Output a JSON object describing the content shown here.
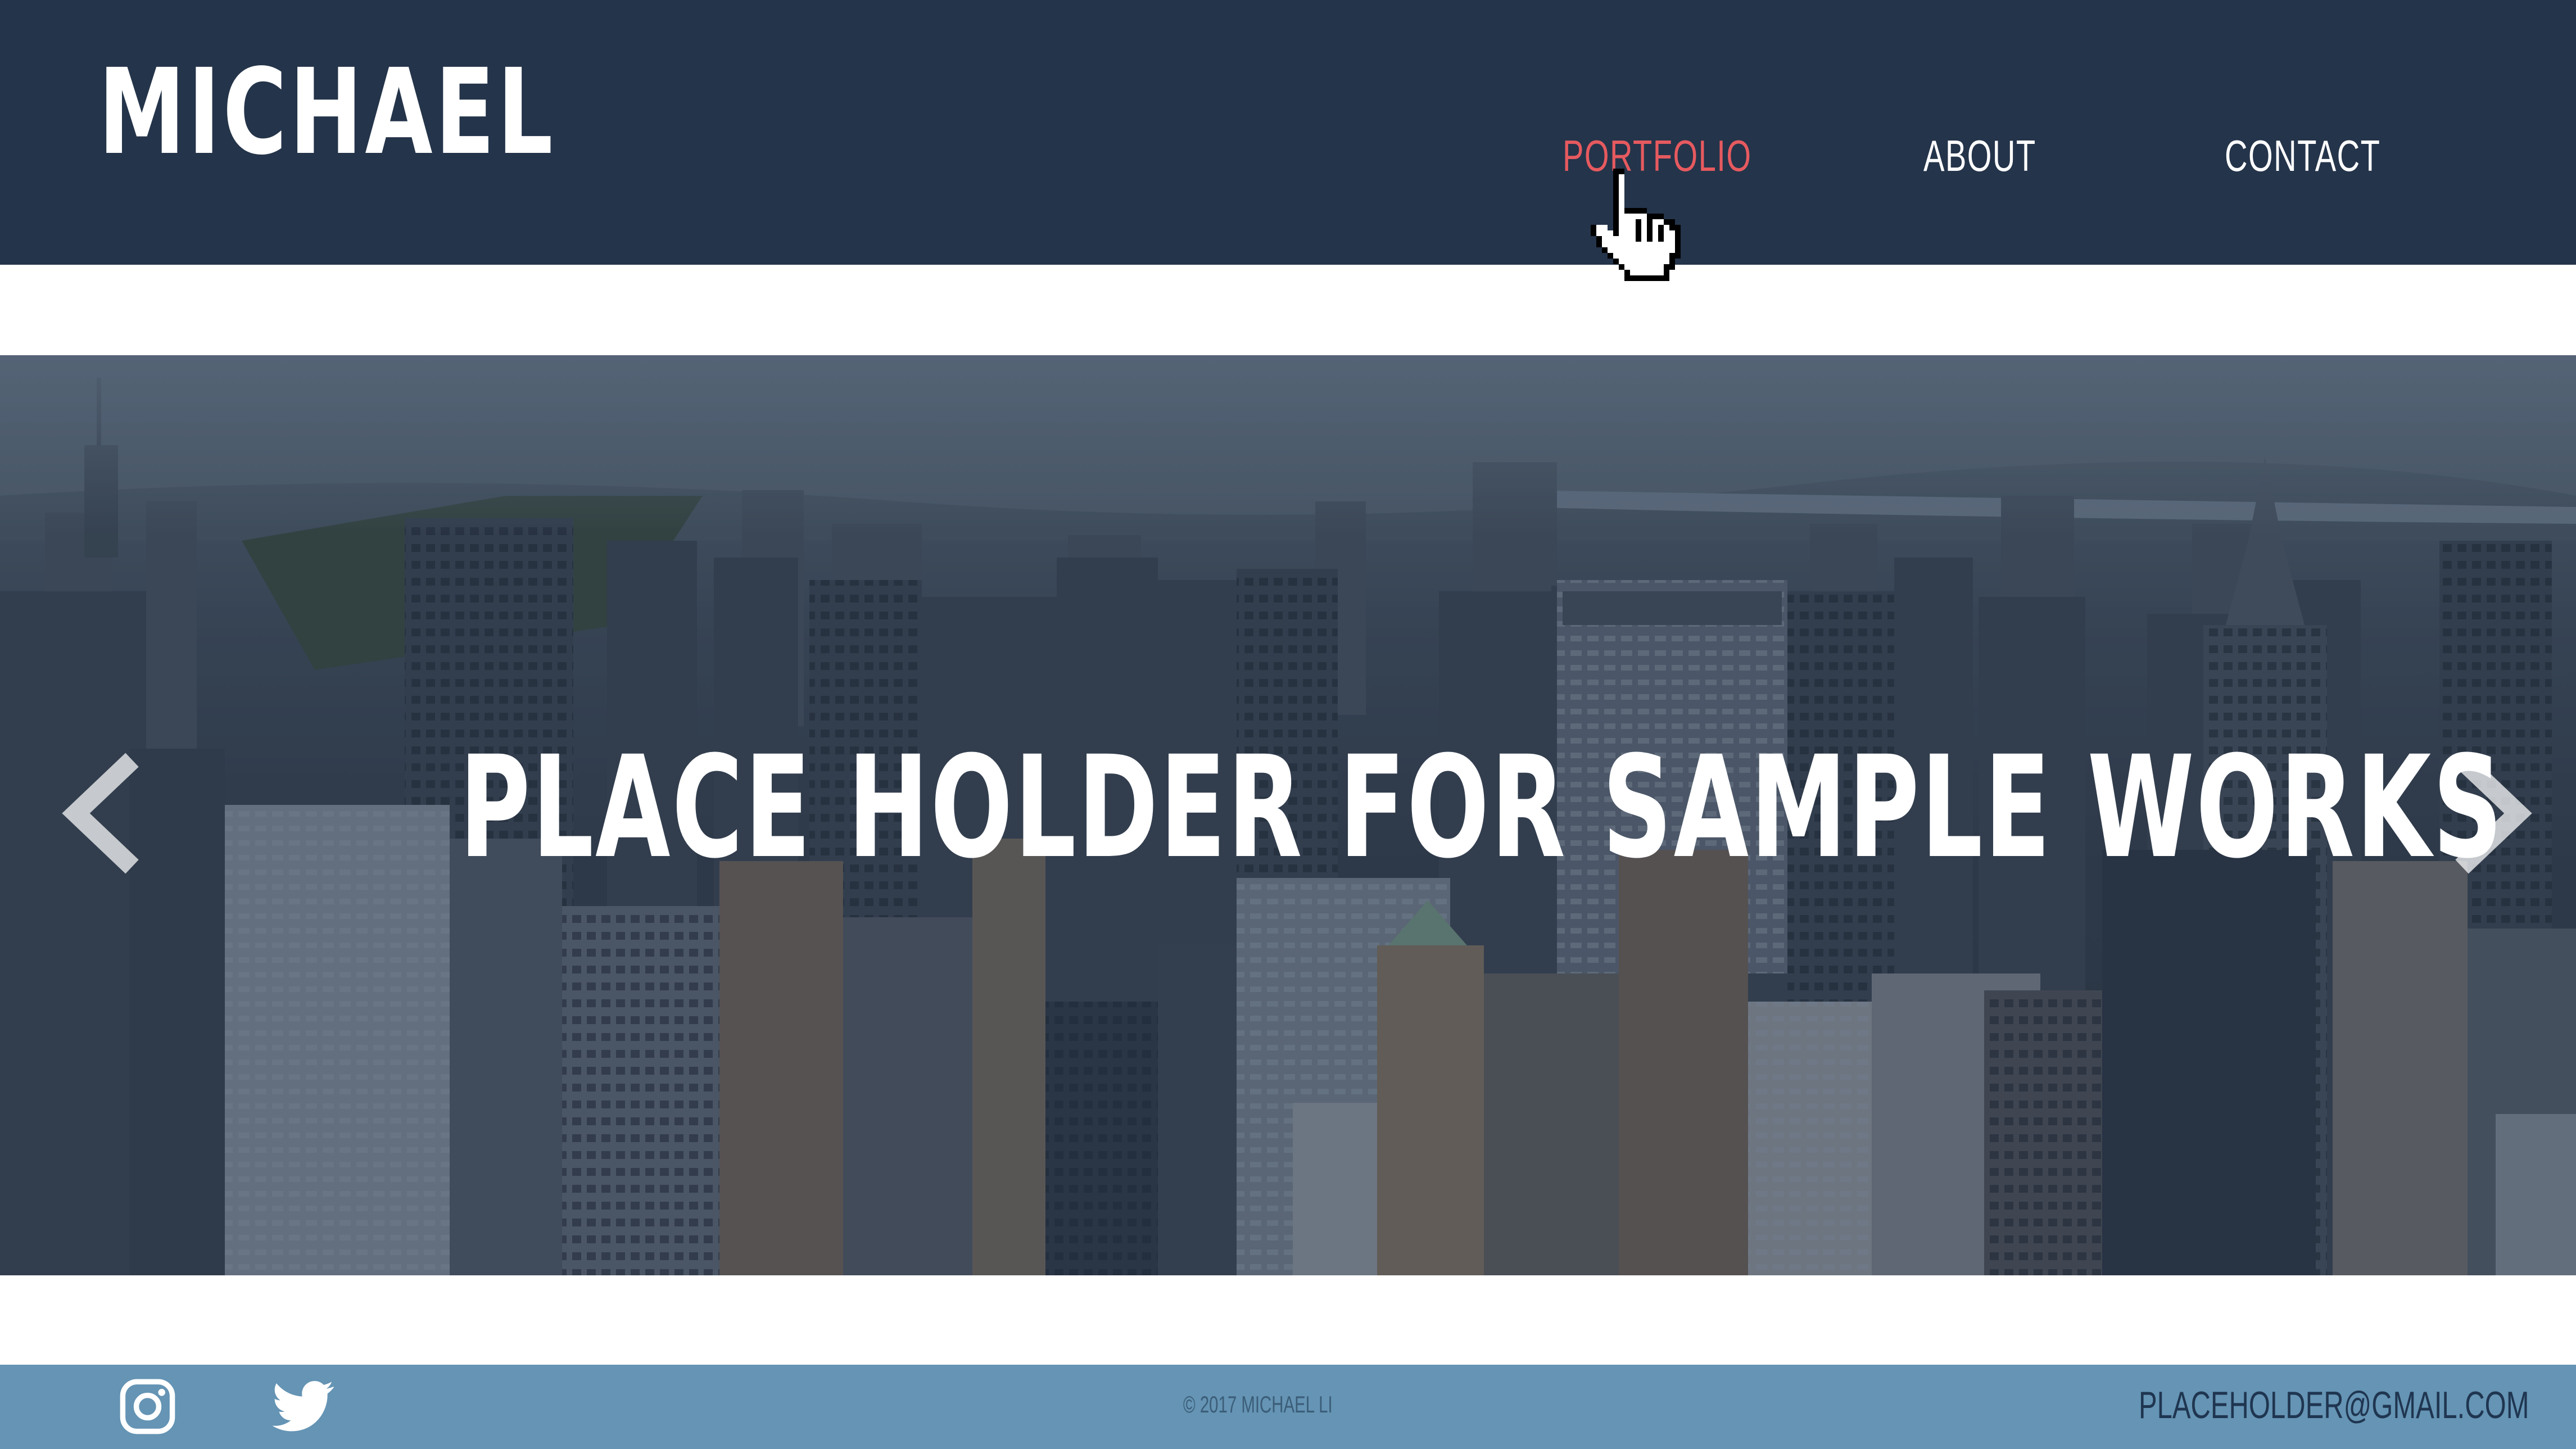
{
  "header": {
    "logo": "MICHAEL",
    "nav": [
      {
        "label": "PORTFOLIO",
        "active": true
      },
      {
        "label": "ABOUT",
        "active": false
      },
      {
        "label": "CONTACT",
        "active": false
      }
    ]
  },
  "hero": {
    "title": "PLACE HOLDER FOR SAMPLE WORKS",
    "background": "aerial-city-skyline-photo",
    "prev_icon": "chevron-left-icon",
    "next_icon": "chevron-right-icon"
  },
  "footer": {
    "social": [
      "instagram-icon",
      "twitter-icon"
    ],
    "copyright": "© 2017 MICHAEL LI",
    "email": "PLACEHOLDER@GMAIL.COM"
  },
  "colors": {
    "header_bg": "#24344a",
    "nav_active": "#e65a5f",
    "footer_bg": "#6594b4"
  }
}
